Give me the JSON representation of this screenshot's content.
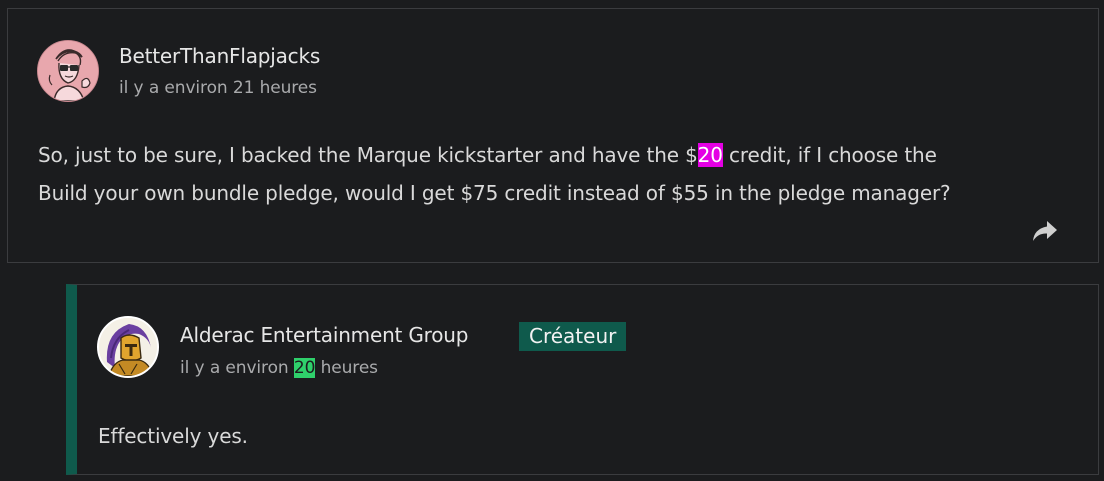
{
  "comment": {
    "author": "BetterThanFlapjacks",
    "timestamp": "il y a environ 21 heures",
    "body_line1_pre": "So, just to be sure, I backed the Marque kickstarter and have the $",
    "body_line1_highlight": "20",
    "body_line1_post": " credit, if I choose the",
    "body_line2": "Build your own bundle pledge, would I get $75 credit instead of $55 in the pledge manager?",
    "share_icon": "share-arrow-icon"
  },
  "reply": {
    "author": "Alderac Entertainment Group",
    "badge": "Créateur",
    "timestamp_pre": "il y a environ ",
    "timestamp_highlight": "20",
    "timestamp_post": " heures",
    "body": "Effectively yes."
  },
  "colors": {
    "background": "#1b1c1e",
    "border": "#3b3c3f",
    "creator_accent": "#0f5a4c",
    "highlight_pink": "#e400e4",
    "highlight_green": "#2fd06b"
  }
}
